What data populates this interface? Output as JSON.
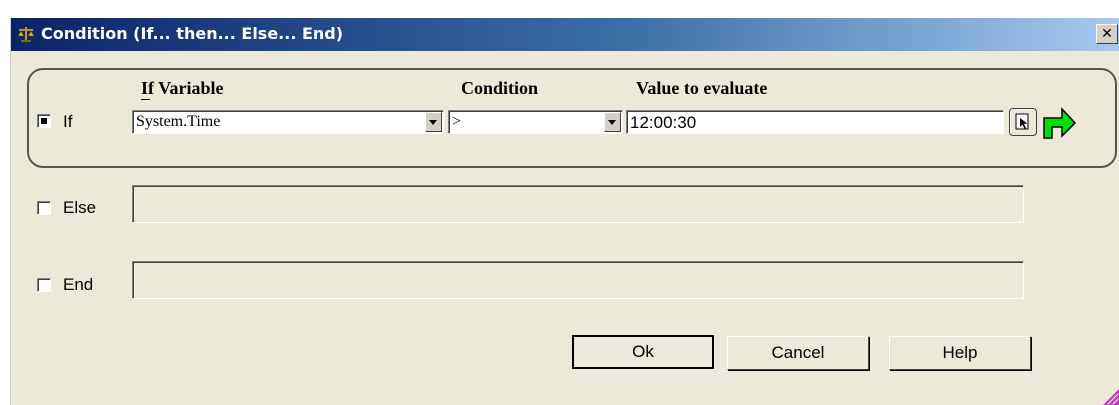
{
  "window": {
    "title": "Condition (If... then... Else... End)",
    "close_glyph": "✕"
  },
  "if_row": {
    "label": "If",
    "checked": true,
    "headers": {
      "variable": "If Variable",
      "condition": "Condition",
      "value": "Value to evaluate"
    },
    "variable_value": "System.Time",
    "condition_value": ">",
    "value_to_evaluate": "12:00:30"
  },
  "else_row": {
    "label": "Else",
    "checked": false,
    "value": ""
  },
  "end_row": {
    "label": "End",
    "checked": false,
    "value": ""
  },
  "buttons": {
    "ok": "Ok",
    "cancel": "Cancel",
    "help": "Help"
  },
  "colors": {
    "titlebar_start": "#0a246a",
    "titlebar_end": "#a6caf0",
    "face": "#ece9d8",
    "arrow_green": "#00e000",
    "grip_purple": "#c040c0"
  },
  "icons": [
    "scales-icon",
    "close-icon",
    "dropdown-arrow-icon",
    "variable-picker-icon",
    "green-arrow-icon",
    "resize-grip-icon"
  ]
}
